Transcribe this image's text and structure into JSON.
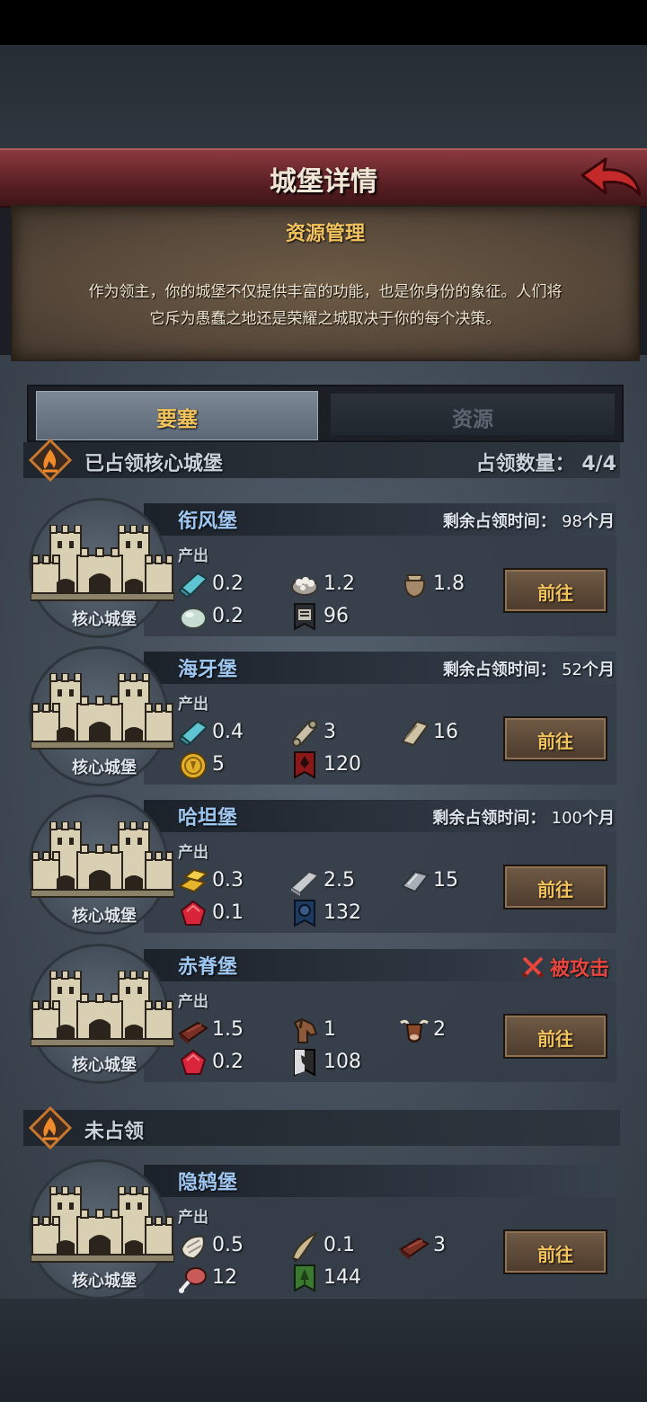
{
  "header": {
    "title": "城堡详情"
  },
  "info": {
    "title": "资源管理",
    "line1": "作为领主，你的城堡不仅提供丰富的功能，也是你身份的象征。人们将",
    "line2": "它斥为愚蠢之地还是荣耀之城取决于你的每个决策。"
  },
  "tabs": [
    {
      "label": "要塞",
      "active": true
    },
    {
      "label": "资源",
      "active": false
    }
  ],
  "occupied": {
    "title": "已占领核心城堡",
    "count_label": "占领数量：",
    "count": "4/4"
  },
  "unoccupied": {
    "title": "未占领"
  },
  "remaining_label": "剩余占领时间：",
  "output_label": "产出",
  "core_label": "核心城堡",
  "go_label": "前往",
  "castles": [
    {
      "name": "衔风堡",
      "status": "remaining",
      "remaining_value": "98",
      "remaining_unit": "个月",
      "resources": [
        {
          "icon": "cloth-icon",
          "value": "0.2"
        },
        {
          "icon": "cotton-icon",
          "value": "1.2"
        },
        {
          "icon": "sack-icon",
          "value": "1.8"
        },
        {
          "icon": "stone-icon",
          "value": "0.2"
        },
        {
          "icon": "troop-banner-icon",
          "value": "96"
        }
      ]
    },
    {
      "name": "海牙堡",
      "status": "remaining",
      "remaining_value": "52",
      "remaining_unit": "个月",
      "resources": [
        {
          "icon": "cloth-icon",
          "value": "0.4"
        },
        {
          "icon": "scroll-icon",
          "value": "3"
        },
        {
          "icon": "parchment-icon",
          "value": "16"
        },
        {
          "icon": "gold-coin-icon",
          "value": "5"
        },
        {
          "icon": "troop-banner-icon",
          "value": "120"
        }
      ]
    },
    {
      "name": "哈坦堡",
      "status": "remaining",
      "remaining_value": "100",
      "remaining_unit": "个月",
      "resources": [
        {
          "icon": "gold-bar-icon",
          "value": "0.3"
        },
        {
          "icon": "iron-bar-icon",
          "value": "2.5"
        },
        {
          "icon": "steel-ingot-icon",
          "value": "15"
        },
        {
          "icon": "ruby-icon",
          "value": "0.1"
        },
        {
          "icon": "troop-banner-icon",
          "value": "132"
        }
      ]
    },
    {
      "name": "赤脊堡",
      "status": "attacked",
      "attacked_label": "被攻击",
      "resources": [
        {
          "icon": "wood-icon",
          "value": "1.5"
        },
        {
          "icon": "horse-icon",
          "value": "1"
        },
        {
          "icon": "cattle-icon",
          "value": "2"
        },
        {
          "icon": "ruby-icon",
          "value": "0.2"
        },
        {
          "icon": "troop-banner-icon",
          "value": "108"
        }
      ]
    },
    {
      "name": "隐鸫堡",
      "status": "none",
      "resources": [
        {
          "icon": "fur-icon",
          "value": "0.5"
        },
        {
          "icon": "horn-icon",
          "value": "0.1"
        },
        {
          "icon": "wood-icon",
          "value": "3"
        },
        {
          "icon": "meat-icon",
          "value": "12"
        },
        {
          "icon": "troop-banner-icon",
          "value": "144"
        }
      ]
    }
  ],
  "colors": {
    "header_red": "#6e2a2f",
    "gold_text": "#f2c35c",
    "castle_name_blue": "#9ec7f2",
    "attacked_red": "#e8453c",
    "card_bg": "#343c46"
  }
}
